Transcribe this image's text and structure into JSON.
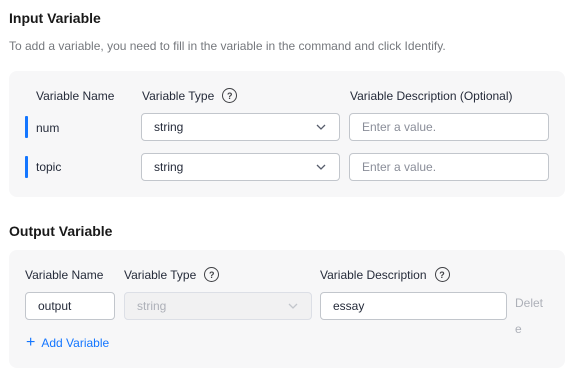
{
  "input_section": {
    "title": "Input Variable",
    "description": "To add a variable, you need to fill in the variable in the command and click Identify.",
    "headers": {
      "name": "Variable Name",
      "type": "Variable Type",
      "description": "Variable Description (Optional)"
    },
    "help_icon": "?",
    "rows": [
      {
        "name": "num",
        "type": "string",
        "description_placeholder": "Enter a value."
      },
      {
        "name": "topic",
        "type": "string",
        "description_placeholder": "Enter a value."
      }
    ]
  },
  "output_section": {
    "title": "Output Variable",
    "headers": {
      "name": "Variable Name",
      "type": "Variable Type",
      "description": "Variable Description"
    },
    "help_icon": "?",
    "row": {
      "name": "output",
      "type": "string",
      "description": "essay"
    },
    "delete_label": "Delete",
    "add_label": "Add Variable",
    "add_icon": "+"
  },
  "colors": {
    "accent": "#1476ff",
    "panel_bg": "#f7f7f8",
    "border": "#c2c6cc",
    "disabled_text": "#adb0b8"
  },
  "icons": {
    "help": "question-circle-icon",
    "dropdown": "chevron-down-icon",
    "add": "plus-icon"
  }
}
